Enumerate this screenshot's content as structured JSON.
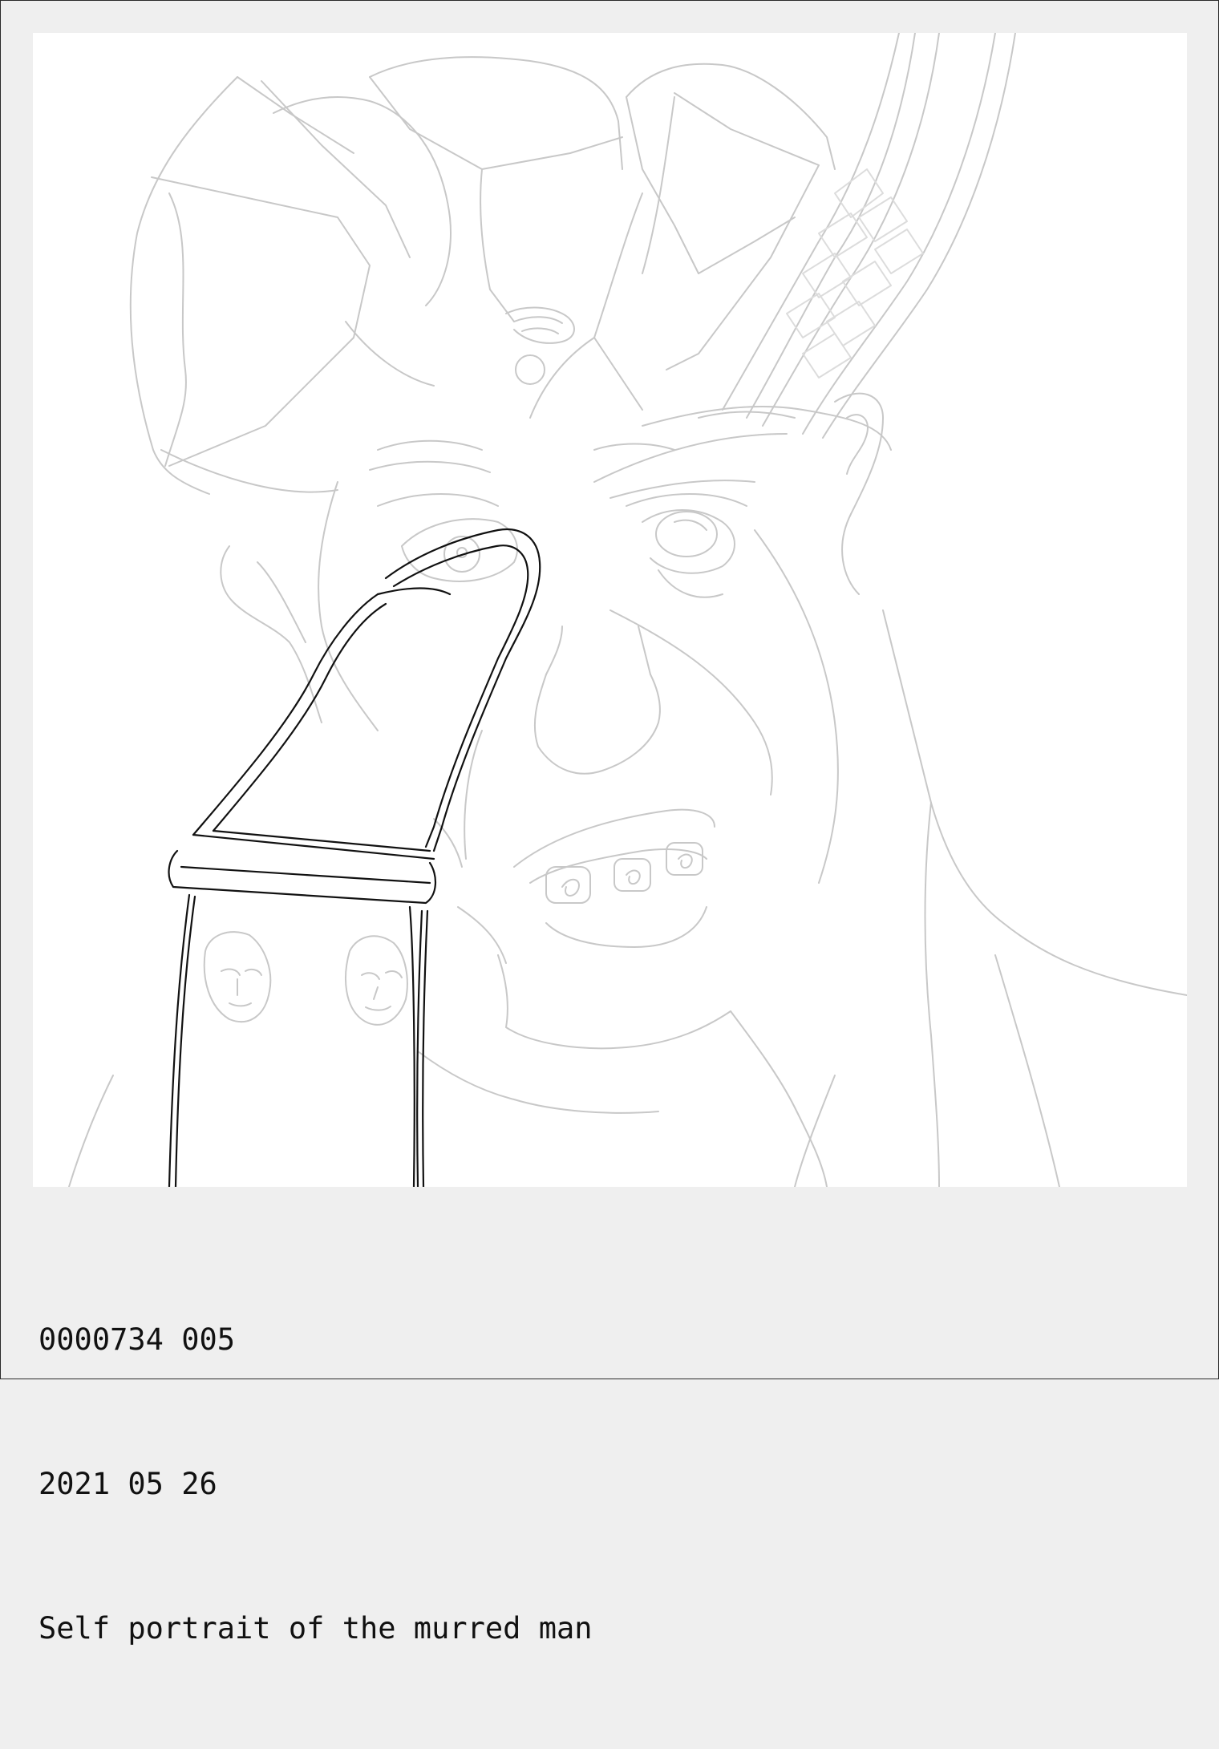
{
  "caption": {
    "id": "0000734 005",
    "date": "2021 05 26",
    "title": "Self portrait of the murred man"
  },
  "colors": {
    "background": "#efefef",
    "canvas": "#ffffff",
    "sketch_light": "#c8c8c8",
    "sketch_dark": "#111111",
    "text": "#111111"
  }
}
